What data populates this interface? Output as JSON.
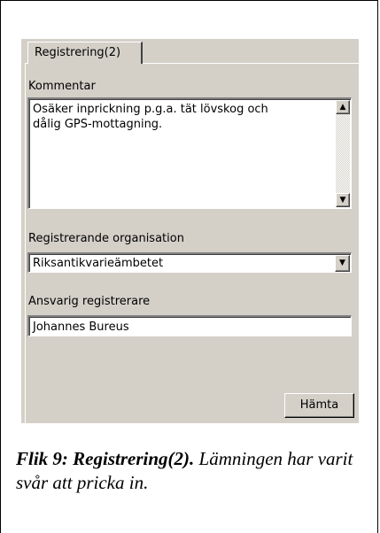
{
  "tab": {
    "label": "Registrering(2)"
  },
  "kommentar": {
    "label": "Kommentar",
    "value": "Osäker inprickning p.g.a. tät lövskog och\ndålig GPS-mottagning."
  },
  "organisation": {
    "label": "Registrerande organisation",
    "selected": "Riksantikvarieämbetet"
  },
  "registrerare": {
    "label": "Ansvarig registrerare",
    "value": "Johannes Bureus"
  },
  "hamta_button": {
    "label": "Hämta"
  },
  "caption": {
    "bold": "Flik 9: Registrering(2).",
    "text": " Lämningen har varit svår att pricka in."
  },
  "icons": {
    "scroll_up": "arrow-up-icon",
    "scroll_down": "arrow-down-icon",
    "dropdown": "chevron-down-icon"
  }
}
